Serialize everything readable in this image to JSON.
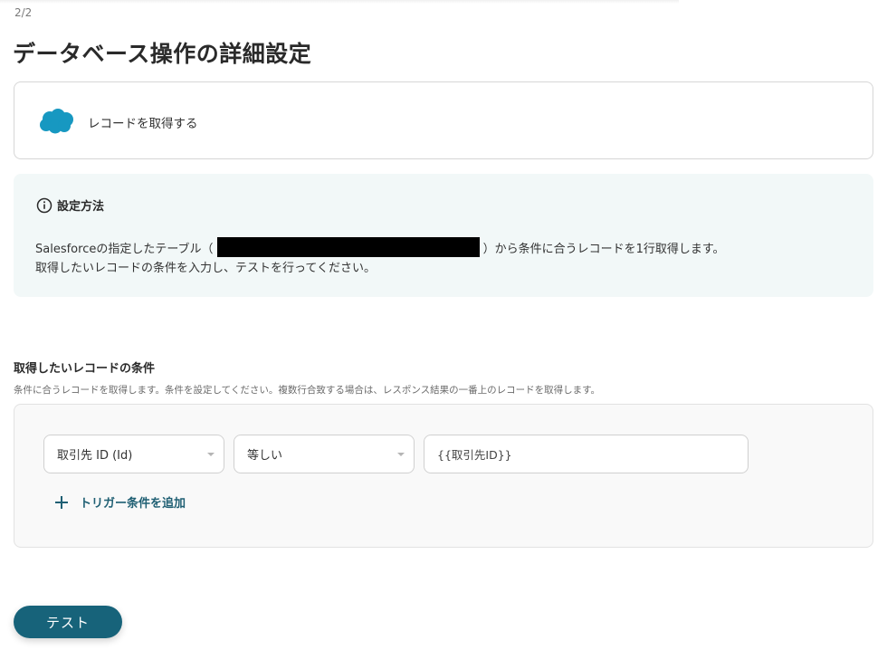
{
  "step": "2/2",
  "page_title": "データベース操作の詳細設定",
  "app_card": {
    "logo_icon": "salesforce-cloud-icon",
    "brand_color": "#1798c1",
    "action": "レコードを取得する"
  },
  "info": {
    "icon": "info-circle-icon",
    "title": "設定方法",
    "line1_prefix": "Salesforceの指定したテーブル（",
    "line1_suffix": "）から条件に合うレコードを1行取得します。",
    "line2": "取得したいレコードの条件を入力し、テストを行ってください。"
  },
  "conditions": {
    "title": "取得したいレコードの条件",
    "description": "条件に合うレコードを取得します。条件を設定してください。複数行合致する場合は、レスポンス結果の一番上のレコードを取得します。",
    "field": "取引先 ID (Id)",
    "operator": "等しい",
    "value": "{{取引先ID}}",
    "add_label": "トリガー条件を追加"
  },
  "test_button": "テスト",
  "colors": {
    "accent": "#17637a",
    "info_bg": "#f2f8f8"
  }
}
